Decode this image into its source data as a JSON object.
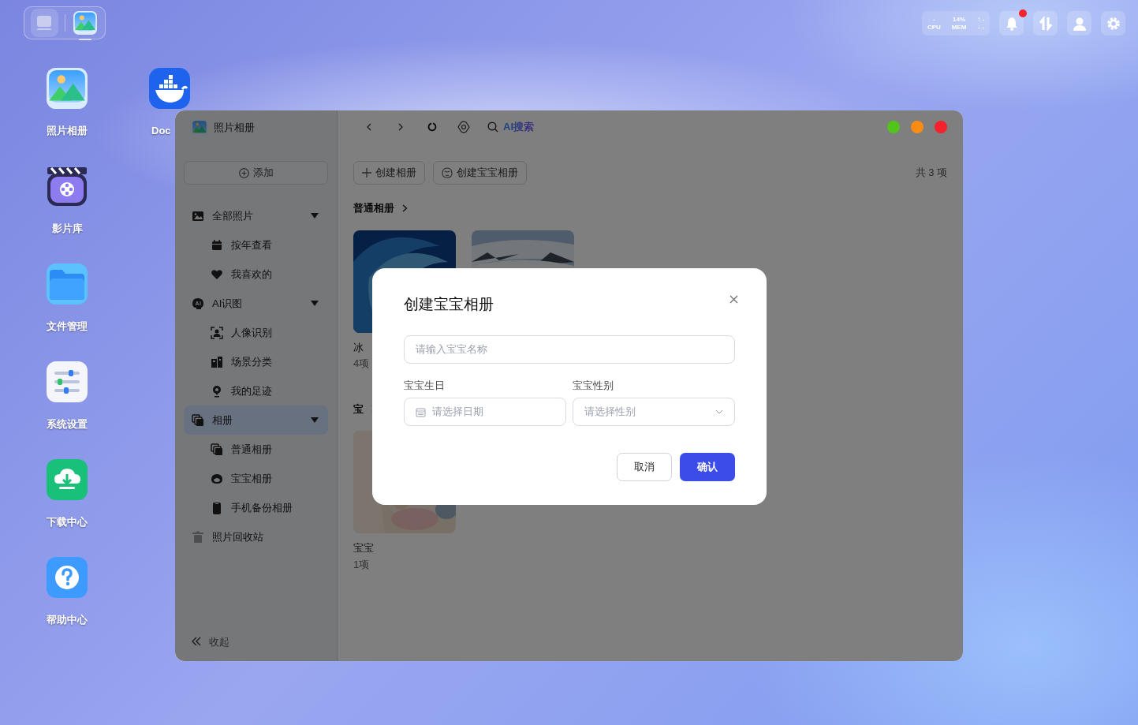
{
  "taskbar": [
    {
      "selected": false
    },
    {
      "selected": true
    }
  ],
  "desktop_icons": [
    {
      "label": "照片相册"
    },
    {
      "label": "Doc"
    },
    {
      "label": "影片库"
    },
    {
      "label": "文件管理"
    },
    {
      "label": "系统设置"
    },
    {
      "label": "下载中心"
    },
    {
      "label": "帮助中心"
    }
  ],
  "system_tray": {
    "cpu_value": "-",
    "cpu_label": "CPU",
    "mem_value": "14%",
    "mem_label": "MEM",
    "upload": "↑ -",
    "download": "↓ -",
    "unread": true
  },
  "window": {
    "title": "照片相册",
    "traffic_lights": [
      {
        "color": "#52c41a"
      },
      {
        "color": "#fa8c16"
      },
      {
        "color": "#f5222d"
      }
    ],
    "search_label": "AI搜索",
    "sidebar": {
      "add_button": "添加",
      "collapse": "收起",
      "items": [
        {
          "label": "全部照片",
          "expanded": true,
          "selected": false,
          "children": [
            {
              "label": "按年查看",
              "selected": false
            },
            {
              "label": "我喜欢的",
              "selected": false
            }
          ]
        },
        {
          "label": "AI识图",
          "expanded": true,
          "selected": false,
          "children": [
            {
              "label": "人像识别",
              "selected": false
            },
            {
              "label": "场景分类",
              "selected": false
            },
            {
              "label": "我的足迹",
              "selected": false
            }
          ]
        },
        {
          "label": "相册",
          "expanded": true,
          "selected": true,
          "children": [
            {
              "label": "普通相册",
              "selected": false
            },
            {
              "label": "宝宝相册",
              "selected": false
            },
            {
              "label": "手机备份相册",
              "selected": false
            }
          ]
        },
        {
          "label": "照片回收站",
          "selected": false
        }
      ]
    },
    "actions": [
      "创建相册",
      "创建宝宝相册"
    ],
    "count": "共 3 项",
    "sections": [
      {
        "title": "普通相册",
        "albums": [
          {
            "kind": "picture",
            "name": "冰",
            "count": "4项"
          },
          {
            "kind": "picture"
          }
        ]
      },
      {
        "title": "宝",
        "albums": [
          {
            "kind": "picture",
            "name": "宝宝",
            "count": "1项"
          }
        ]
      }
    ]
  },
  "dialog": {
    "title": "创建宝宝相册",
    "name_placeholder": "请输入宝宝名称",
    "birthday_label": "宝宝生日",
    "birthday_placeholder": "请选择日期",
    "gender_label": "宝宝性别",
    "gender_placeholder": "请选择性别",
    "buttons": [
      {
        "label": "取消",
        "kind": "secondary"
      },
      {
        "label": "确认",
        "kind": "primary"
      }
    ]
  }
}
